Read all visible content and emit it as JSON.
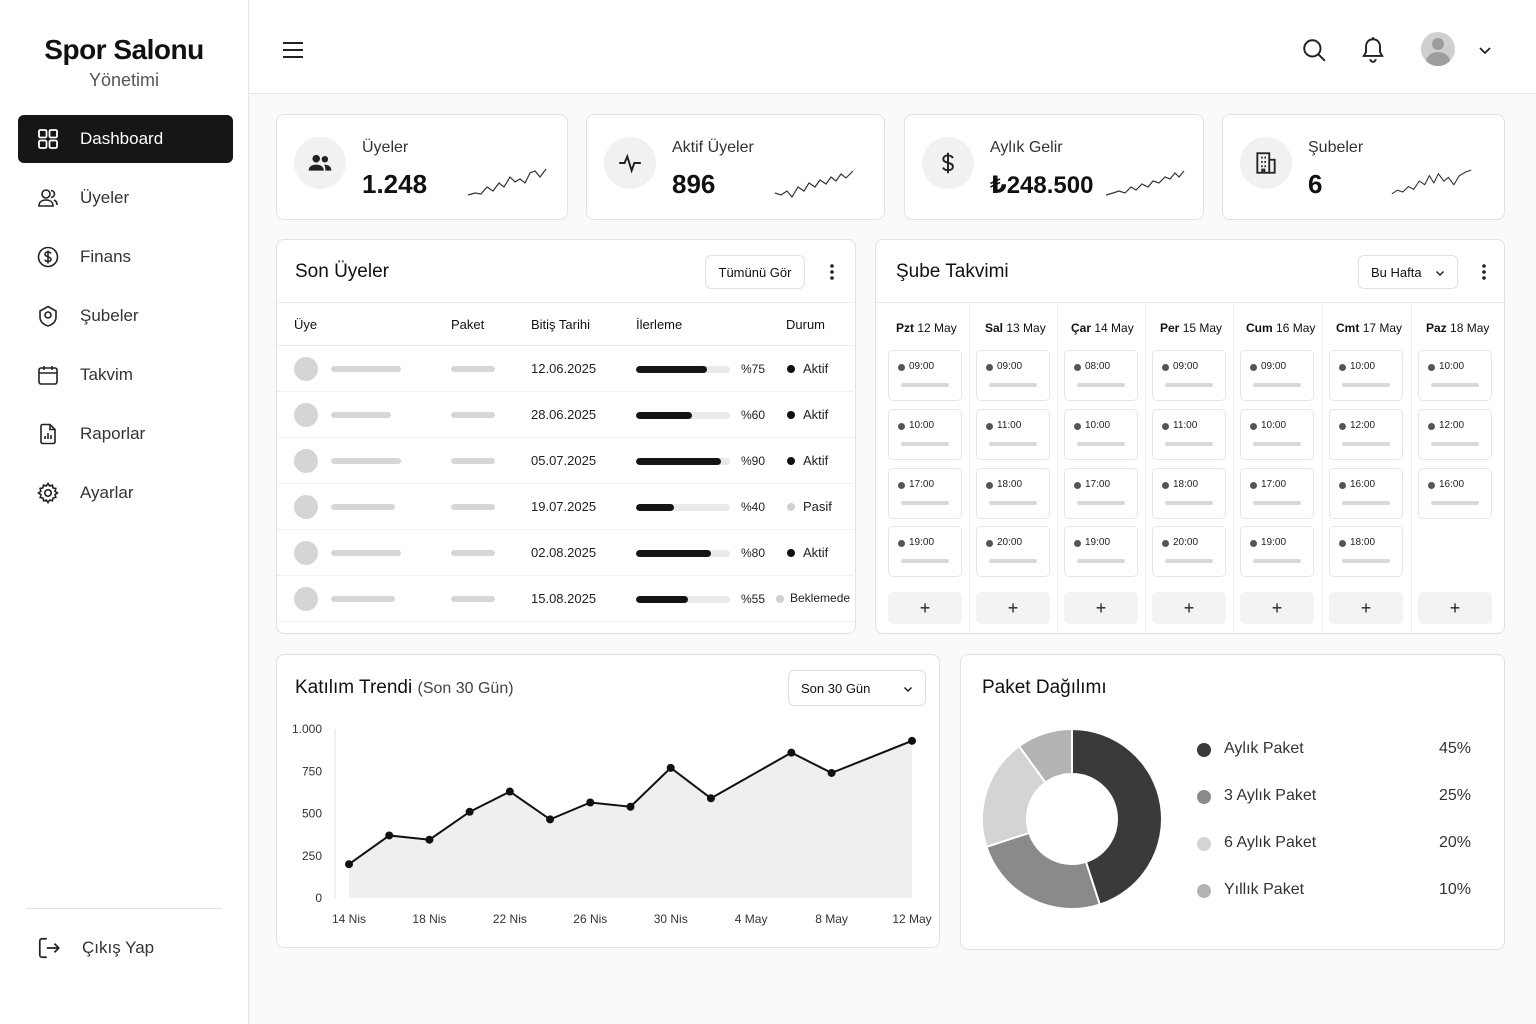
{
  "brand": {
    "title": "Spor Salonu",
    "subtitle": "Yönetimi"
  },
  "sidebar": {
    "items": [
      {
        "label": "Dashboard",
        "icon": "grid-icon",
        "active": true
      },
      {
        "label": "Üyeler",
        "icon": "users-icon"
      },
      {
        "label": "Finans",
        "icon": "dollar-circle-icon"
      },
      {
        "label": "Şubeler",
        "icon": "location-pin-icon"
      },
      {
        "label": "Takvim",
        "icon": "calendar-icon"
      },
      {
        "label": "Raporlar",
        "icon": "report-icon"
      },
      {
        "label": "Ayarlar",
        "icon": "gear-icon"
      }
    ],
    "logout": "Çıkış Yap"
  },
  "stats": [
    {
      "label": "Üyeler",
      "value": "1.248",
      "icon": "users-icon"
    },
    {
      "label": "Aktif Üyeler",
      "value": "896",
      "icon": "pulse-icon"
    },
    {
      "label": "Aylık Gelir",
      "value": "₺248.500",
      "icon": "dollar-icon"
    },
    {
      "label": "Şubeler",
      "value": "6",
      "icon": "building-icon"
    }
  ],
  "members": {
    "title": "Son Üyeler",
    "view_all": "Tümünü Gör",
    "columns": [
      "Üye",
      "Paket",
      "Bitiş Tarihi",
      "İlerleme",
      "Durum"
    ],
    "rows": [
      {
        "end": "12.06.2025",
        "progress": 75,
        "pct": "%75",
        "status": "Aktif",
        "state": "active"
      },
      {
        "end": "28.06.2025",
        "progress": 60,
        "pct": "%60",
        "status": "Aktif",
        "state": "active"
      },
      {
        "end": "05.07.2025",
        "progress": 90,
        "pct": "%90",
        "status": "Aktif",
        "state": "active"
      },
      {
        "end": "19.07.2025",
        "progress": 40,
        "pct": "%40",
        "status": "Pasif",
        "state": "passive"
      },
      {
        "end": "02.08.2025",
        "progress": 80,
        "pct": "%80",
        "status": "Aktif",
        "state": "active"
      },
      {
        "end": "15.08.2025",
        "progress": 55,
        "pct": "%55",
        "status": "Beklemede",
        "state": "pending"
      }
    ]
  },
  "schedule": {
    "title": "Şube Takvimi",
    "range": "Bu Hafta",
    "days": [
      {
        "name": "Pzt",
        "date": "12 May",
        "slots": [
          "09:00",
          "10:00",
          "17:00",
          "19:00"
        ]
      },
      {
        "name": "Sal",
        "date": "13 May",
        "slots": [
          "09:00",
          "11:00",
          "18:00",
          "20:00"
        ]
      },
      {
        "name": "Çar",
        "date": "14 May",
        "slots": [
          "08:00",
          "10:00",
          "17:00",
          "19:00"
        ]
      },
      {
        "name": "Per",
        "date": "15 May",
        "slots": [
          "09:00",
          "11:00",
          "18:00",
          "20:00"
        ]
      },
      {
        "name": "Cum",
        "date": "16 May",
        "slots": [
          "09:00",
          "10:00",
          "17:00",
          "19:00"
        ]
      },
      {
        "name": "Cmt",
        "date": "17 May",
        "slots": [
          "10:00",
          "12:00",
          "16:00",
          "18:00"
        ]
      },
      {
        "name": "Paz",
        "date": "18 May",
        "slots": [
          "10:00",
          "12:00",
          "16:00"
        ]
      }
    ],
    "add_label": "+"
  },
  "trend": {
    "title": "Katılım Trendi",
    "subtitle": "(Son 30 Gün)",
    "range": "Son 30 Gün"
  },
  "package": {
    "title": "Paket Dağılımı"
  },
  "chart_data": [
    {
      "type": "line",
      "title": "Katılım Trendi",
      "x": [
        "14 Nis",
        "16 Nis",
        "18 Nis",
        "20 Nis",
        "22 Nis",
        "24 Nis",
        "26 Nis",
        "28 Nis",
        "30 Nis",
        "2 May",
        "4 May",
        "6 May",
        "8 May",
        "10 May",
        "12 May"
      ],
      "xticks": [
        "14 Nis",
        "18 Nis",
        "22 Nis",
        "26 Nis",
        "30 Nis",
        "4 May",
        "8 May",
        "12 May"
      ],
      "values": [
        200,
        370,
        345,
        510,
        630,
        465,
        565,
        540,
        770,
        590,
        860,
        740,
        930
      ],
      "x_index": [
        0,
        1,
        2,
        3,
        4,
        5,
        6,
        7,
        8,
        9,
        11,
        12,
        14
      ],
      "ylim": [
        0,
        1000
      ],
      "yticks": [
        "0",
        "250",
        "500",
        "750",
        "1.000"
      ],
      "grid": false,
      "area_fill": "#efefef",
      "line_color": "#111111"
    },
    {
      "type": "pie",
      "title": "Paket Dağılımı",
      "donut": true,
      "slices": [
        {
          "label": "Aylık Paket",
          "value": 45,
          "pct": "45%",
          "color": "#3a3a3a"
        },
        {
          "label": "3 Aylık Paket",
          "value": 25,
          "pct": "25%",
          "color": "#8a8a8a"
        },
        {
          "label": "6 Aylık Paket",
          "value": 20,
          "pct": "20%",
          "color": "#d4d4d4"
        },
        {
          "label": "Yıllık Paket",
          "value": 10,
          "pct": "10%",
          "color": "#b3b3b3"
        }
      ]
    }
  ]
}
